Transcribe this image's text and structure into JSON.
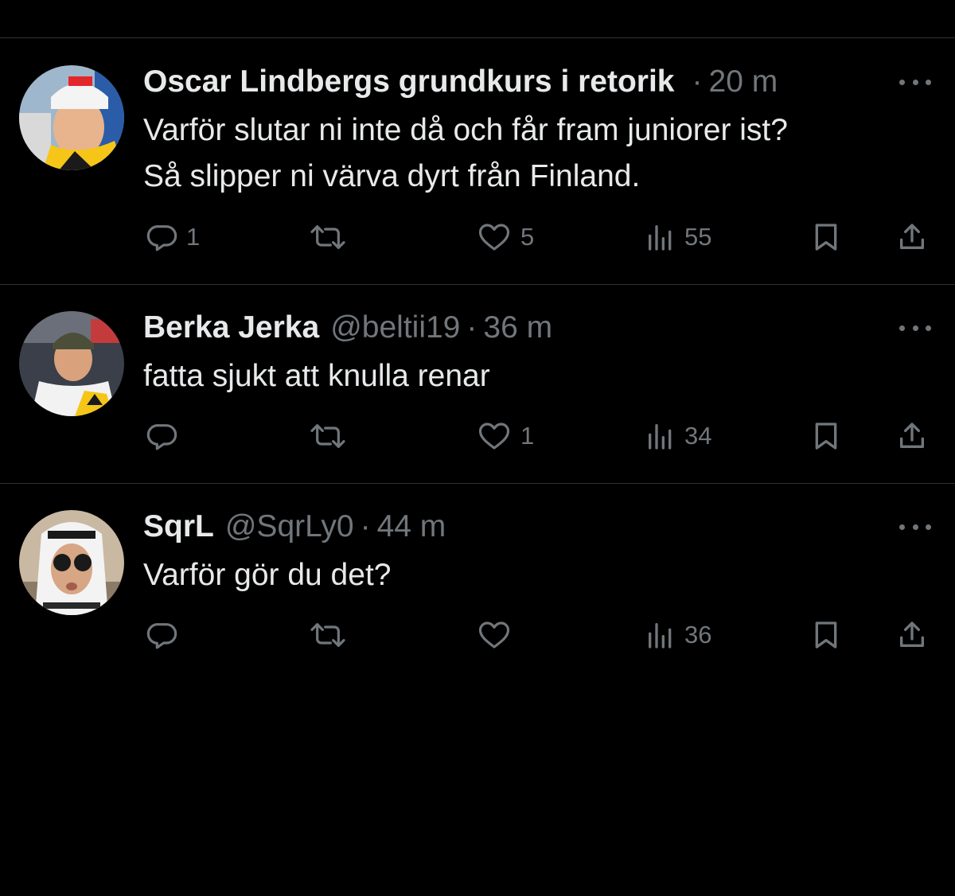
{
  "tweets": [
    {
      "name": "Oscar Lindbergs grundkurs i retorik",
      "handle": "",
      "separator": "·",
      "time": "20 m",
      "text_lines": [
        "Varför slutar ni inte då och får fram juniorer ist?",
        "Så slipper ni värva dyrt från Finland."
      ],
      "reply_count": "1",
      "retweet_count": "",
      "like_count": "5",
      "view_count": "55"
    },
    {
      "name": "Berka Jerka",
      "handle": "@beltii19",
      "separator": "·",
      "time": "36 m",
      "text_lines": [
        "fatta sjukt att knulla renar"
      ],
      "reply_count": "",
      "retweet_count": "",
      "like_count": "1",
      "view_count": "34"
    },
    {
      "name": "SqrL",
      "handle": "@SqrLy0",
      "separator": "·",
      "time": "44 m",
      "text_lines": [
        "Varför gör du det?"
      ],
      "reply_count": "",
      "retweet_count": "",
      "like_count": "",
      "view_count": "36"
    }
  ],
  "icons": {
    "reply": "reply-icon",
    "retweet": "retweet-icon",
    "like": "heart-icon",
    "views": "views-icon",
    "bookmark": "bookmark-icon",
    "share": "share-icon",
    "more": "more-icon"
  },
  "colors": {
    "background": "#000000",
    "text": "#e7e9ea",
    "secondary": "#71767b",
    "divider": "#2f3336"
  }
}
